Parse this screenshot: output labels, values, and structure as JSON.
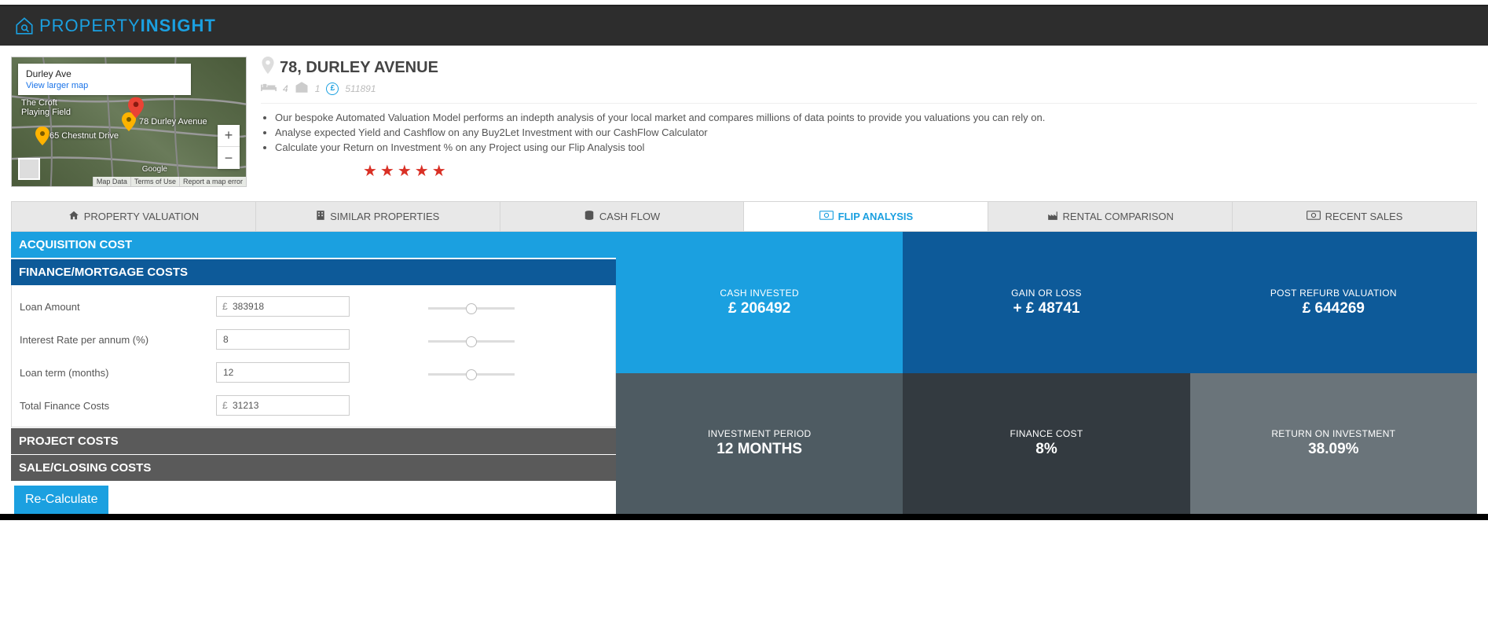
{
  "logo": {
    "light": "PROPERTY",
    "bold": "INSIGHT"
  },
  "map": {
    "title": "Durley Ave",
    "viewLarger": "View larger map",
    "label1": "The Croft\nPlaying Field",
    "label2": "65 Chestnut Drive",
    "label3": "78 Durley Avenue",
    "credits": [
      "Map Data",
      "Terms of Use",
      "Report a map error"
    ],
    "googleLogo": "Google"
  },
  "property": {
    "title": "78, DURLEY AVENUE",
    "beds": "4",
    "garages": "1",
    "price": "511891"
  },
  "bullets": [
    "Our bespoke Automated Valuation Model performs an indepth analysis of your local market and compares millions of data points to provide you valuations you can rely on.",
    "Analyse expected Yield and Cashflow on any Buy2Let Investment with our CashFlow Calculator",
    "Calculate your Return on Investment % on any Project using our Flip Analysis tool"
  ],
  "tabs": {
    "valuation": "PROPERTY VALUATION",
    "similar": "SIMILAR PROPERTIES",
    "cashflow": "CASH FLOW",
    "flip": "FLIP ANALYSIS",
    "rental": "RENTAL COMPARISON",
    "recent": "RECENT SALES"
  },
  "accordion": {
    "acquisition": "ACQUISITION COST",
    "finance": "FINANCE/MORTGAGE COSTS",
    "project": "PROJECT COSTS",
    "sale": "SALE/CLOSING COSTS"
  },
  "form": {
    "loanAmount": {
      "label": "Loan Amount",
      "value": "383918"
    },
    "interestRate": {
      "label": "Interest Rate per annum (%)",
      "value": "8"
    },
    "loanTerm": {
      "label": "Loan term (months)",
      "value": "12"
    },
    "totalFinance": {
      "label": "Total Finance Costs",
      "value": "31213"
    }
  },
  "recalcLabel": "Re-Calculate",
  "results": {
    "cashInvested": {
      "label": "CASH INVESTED",
      "value": "£ 206492"
    },
    "gainLoss": {
      "label": "GAIN OR LOSS",
      "value": "+ £ 48741"
    },
    "postRefurb": {
      "label": "POST REFURB VALUATION",
      "value": "£ 644269"
    },
    "investPeriod": {
      "label": "INVESTMENT PERIOD",
      "value": "12 MONTHS"
    },
    "financeCost": {
      "label": "FINANCE COST",
      "value": "8%"
    },
    "roi": {
      "label": "RETURN ON INVESTMENT",
      "value": "38.09%"
    }
  }
}
